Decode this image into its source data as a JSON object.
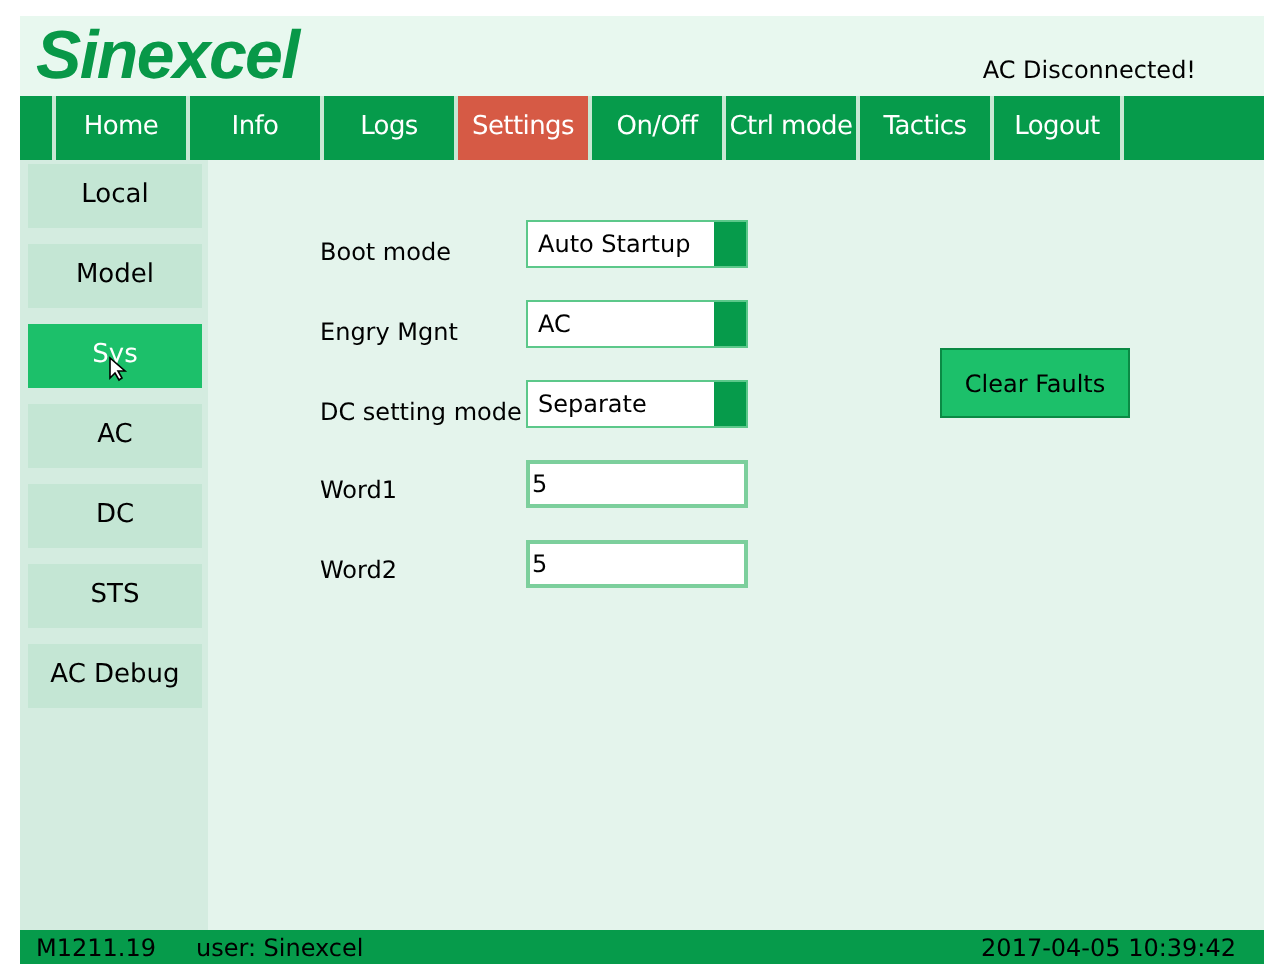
{
  "header": {
    "logo": "Sinexcel",
    "status": "AC Disconnected!"
  },
  "nav": [
    {
      "label": "Home",
      "selected": false
    },
    {
      "label": "Info",
      "selected": false
    },
    {
      "label": "Logs",
      "selected": false
    },
    {
      "label": "Settings",
      "selected": true
    },
    {
      "label": "On/Off",
      "selected": false
    },
    {
      "label": "Ctrl mode",
      "selected": false
    },
    {
      "label": "Tactics",
      "selected": false
    },
    {
      "label": "Logout",
      "selected": false
    }
  ],
  "sidebar": [
    {
      "label": "Local",
      "selected": false
    },
    {
      "label": "Model",
      "selected": false
    },
    {
      "label": "Sys",
      "selected": true
    },
    {
      "label": "AC",
      "selected": false
    },
    {
      "label": "DC",
      "selected": false
    },
    {
      "label": "STS",
      "selected": false
    },
    {
      "label": "AC Debug",
      "selected": false
    }
  ],
  "fields": [
    {
      "label": "Boot mode",
      "value": "Auto Startup",
      "kind": "select"
    },
    {
      "label": "Engry Mgnt",
      "value": "AC",
      "kind": "select"
    },
    {
      "label": "DC setting mode",
      "value": "Separate",
      "kind": "select"
    },
    {
      "label": "Word1",
      "value": "5",
      "kind": "input"
    },
    {
      "label": "Word2",
      "value": "5",
      "kind": "input"
    }
  ],
  "clear_button": "Clear Faults",
  "status_bar": {
    "version": "M1211.19",
    "user": "user: Sinexcel",
    "datetime": "2017-04-05 10:39:42"
  }
}
